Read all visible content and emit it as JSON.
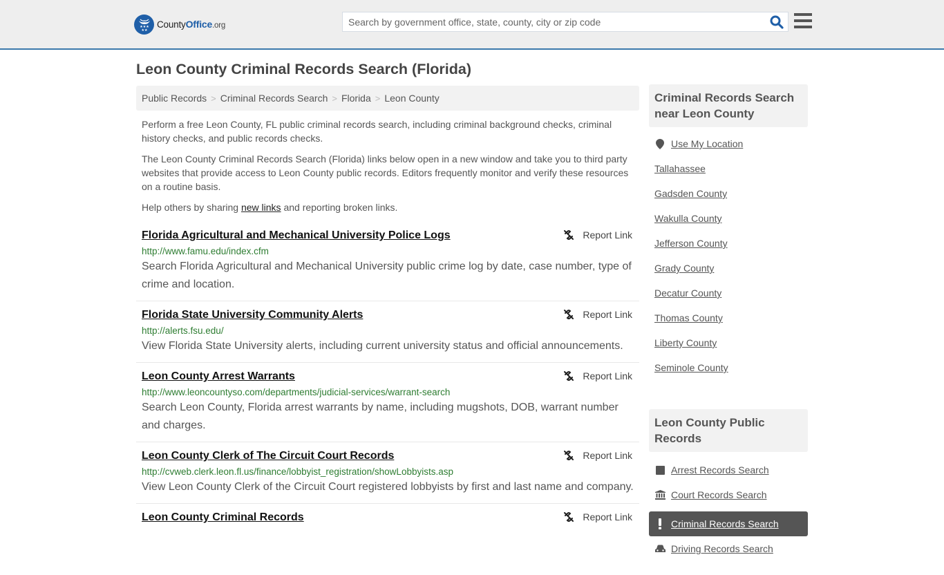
{
  "header": {
    "logo": {
      "part1": "County",
      "part2": "Office",
      "part3": ".org"
    },
    "search": {
      "placeholder": "Search by government office, state, county, city or zip code",
      "value": ""
    }
  },
  "page": {
    "title": "Leon County Criminal Records Search (Florida)"
  },
  "breadcrumb": [
    {
      "label": "Public Records"
    },
    {
      "label": "Criminal Records Search"
    },
    {
      "label": "Florida"
    },
    {
      "label": "Leon County"
    }
  ],
  "breadcrumb_separator": ">",
  "intro": {
    "p1": "Perform a free Leon County, FL public criminal records search, including criminal background checks, criminal history checks, and public records checks.",
    "p2": "The Leon County Criminal Records Search (Florida) links below open in a new window and take you to third party websites that provide access to Leon County public records. Editors frequently monitor and verify these resources on a routine basis.",
    "p3_before": "Help others by sharing ",
    "p3_link": "new links",
    "p3_after": " and reporting broken links."
  },
  "report_label": "Report Link",
  "results": [
    {
      "title": "Florida Agricultural and Mechanical University Police Logs",
      "url": "http://www.famu.edu/index.cfm",
      "description": "Search Florida Agricultural and Mechanical University public crime log by date, case number, type of crime and location."
    },
    {
      "title": "Florida State University Community Alerts",
      "url": "http://alerts.fsu.edu/",
      "description": "View Florida State University alerts, including current university status and official announcements."
    },
    {
      "title": "Leon County Arrest Warrants",
      "url": "http://www.leoncountyso.com/departments/judicial-services/warrant-search",
      "description": "Search Leon County, Florida arrest warrants by name, including mugshots, DOB, warrant number and charges."
    },
    {
      "title": "Leon County Clerk of The Circuit Court Records",
      "url": "http://cvweb.clerk.leon.fl.us/finance/lobbyist_registration/showLobbyists.asp",
      "description": "View Leon County Clerk of the Circuit Court registered lobbyists by first and last name and company."
    },
    {
      "title": "Leon County Criminal Records",
      "url": "",
      "description": ""
    }
  ],
  "sidebar": {
    "nearby": {
      "heading": "Criminal Records Search near Leon County",
      "use_location": "Use My Location",
      "items": [
        "Tallahassee",
        "Gadsden County",
        "Wakulla County",
        "Jefferson County",
        "Grady County",
        "Decatur County",
        "Thomas County",
        "Liberty County",
        "Seminole County"
      ]
    },
    "public_records": {
      "heading": "Leon County Public Records",
      "items": [
        {
          "label": "Arrest Records Search",
          "icon": "square-icon",
          "active": false
        },
        {
          "label": "Court Records Search",
          "icon": "courthouse-icon",
          "active": false
        },
        {
          "label": "Criminal Records Search",
          "icon": "exclamation-icon",
          "active": true
        },
        {
          "label": "Driving Records Search",
          "icon": "car-icon",
          "active": false
        }
      ]
    }
  },
  "colors": {
    "brand_blue": "#1f5fa8",
    "header_border": "#3b79ab",
    "url_green": "#2e7d32",
    "active_bg": "#555555"
  }
}
